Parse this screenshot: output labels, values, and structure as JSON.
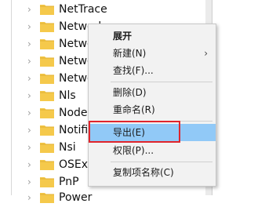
{
  "tree": {
    "items": [
      {
        "label": "NetTrace"
      },
      {
        "label": "Network"
      },
      {
        "label": "Netwo"
      },
      {
        "label": "Netwo"
      },
      {
        "label": "Netwo"
      },
      {
        "label": "Nls"
      },
      {
        "label": "Node"
      },
      {
        "label": "Notifi"
      },
      {
        "label": "Nsi"
      },
      {
        "label": "OSExt"
      },
      {
        "label": "PnP"
      },
      {
        "label": "Power"
      }
    ]
  },
  "context_menu": {
    "items": [
      {
        "label": "展开",
        "bold": true
      },
      {
        "label": "新建(N)",
        "has_submenu": true
      },
      {
        "label": "查找(F)..."
      },
      {
        "label": "删除(D)"
      },
      {
        "label": "重命名(R)"
      },
      {
        "label": "导出(E)",
        "highlighted": true
      },
      {
        "label": "权限(P)..."
      },
      {
        "label": "复制项名称(C)"
      }
    ],
    "highlight_color": "#91c9f7",
    "callout_color": "#e0252c"
  },
  "icons": {
    "folder": "folder-icon",
    "expand": "chevron-right-icon",
    "submenu": "chevron-right-icon"
  }
}
